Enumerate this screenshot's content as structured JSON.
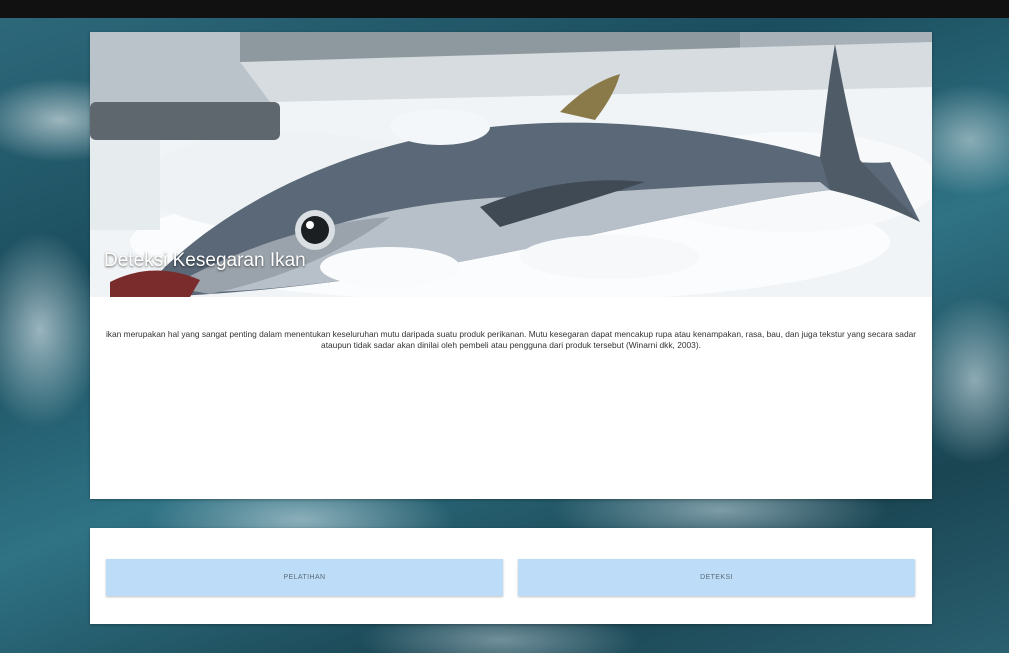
{
  "window": {
    "corner_label": "",
    "corner_right": ""
  },
  "hero": {
    "title": "Deteksi Kesegaran Ikan",
    "image_icon": "fish-on-ice-image"
  },
  "description": "ikan merupakan hal yang sangat penting dalam menentukan keseluruhan mutu daripada suatu produk perikanan. Mutu kesegaran dapat mencakup rupa atau kenampakan, rasa, bau, dan juga tekstur yang secara sadar ataupun tidak sadar akan dinilai oleh pembeli atau pengguna dari produk tersebut (Winarni dkk, 2003).",
  "actions": {
    "pelatihan_label": "PELATIHAN",
    "deteksi_label": "DETEKSI"
  },
  "colors": {
    "button_bg": "#bcdcf7",
    "card_bg": "#ffffff"
  }
}
